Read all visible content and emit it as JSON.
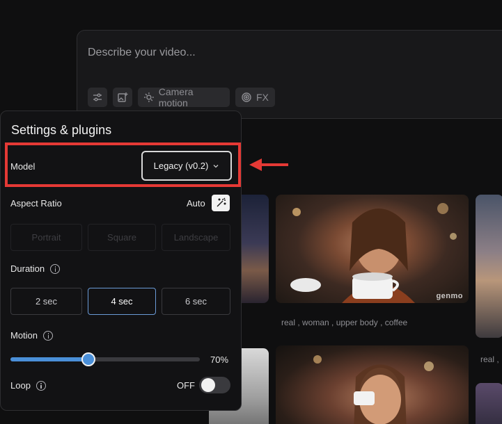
{
  "prompt": {
    "placeholder": "Describe your video...",
    "tools": [
      {
        "icon": "sliders-icon"
      },
      {
        "icon": "add-image-icon"
      },
      {
        "icon": "camera-motion-icon",
        "label": "Camera motion"
      },
      {
        "icon": "fx-icon",
        "label": "FX"
      }
    ]
  },
  "gallery": {
    "items": [
      {
        "caption": "real , woman , upper body , coffee",
        "watermark": "genmo"
      },
      {
        "caption": "real , "
      }
    ]
  },
  "settings": {
    "title": "Settings & plugins",
    "model": {
      "label": "Model",
      "value": "Legacy (v0.2)"
    },
    "aspect_ratio": {
      "label": "Aspect Ratio",
      "mode": "Auto",
      "options": [
        "Portrait",
        "Square",
        "Landscape"
      ]
    },
    "duration": {
      "label": "Duration",
      "options": [
        "2 sec",
        "4 sec",
        "6 sec"
      ],
      "selected": "4 sec"
    },
    "motion": {
      "label": "Motion",
      "value": 70,
      "value_label": "70%"
    },
    "loop": {
      "label": "Loop",
      "state": "OFF"
    }
  },
  "colors": {
    "accent": "#4a8fd8",
    "highlight": "#e53935"
  }
}
